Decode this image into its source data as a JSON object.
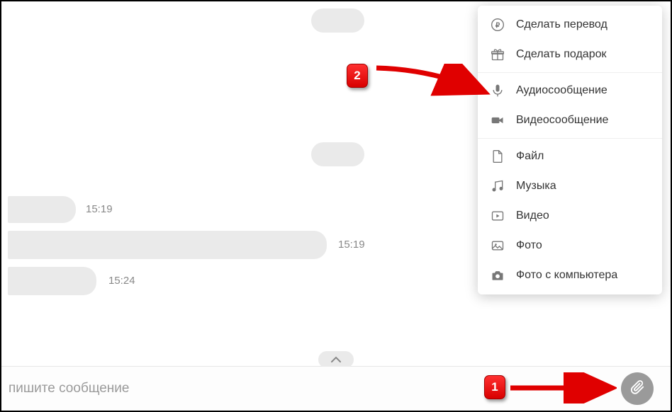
{
  "chat": {
    "timestamps": [
      "15:19",
      "15:19",
      "15:24"
    ],
    "input_placeholder": "пишите сообщение"
  },
  "attach_menu": {
    "items": [
      {
        "label": "Сделать перевод",
        "icon": "ruble-icon"
      },
      {
        "label": "Сделать подарок",
        "icon": "gift-icon"
      },
      {
        "label": "Аудиосообщение",
        "icon": "mic-icon"
      },
      {
        "label": "Видеосообщение",
        "icon": "videocam-icon"
      },
      {
        "label": "Файл",
        "icon": "file-icon"
      },
      {
        "label": "Музыка",
        "icon": "music-icon"
      },
      {
        "label": "Видео",
        "icon": "video-icon"
      },
      {
        "label": "Фото",
        "icon": "photo-icon"
      },
      {
        "label": "Фото с компьютера",
        "icon": "camera-icon"
      }
    ]
  },
  "annotations": {
    "badge1": "1",
    "badge2": "2"
  }
}
